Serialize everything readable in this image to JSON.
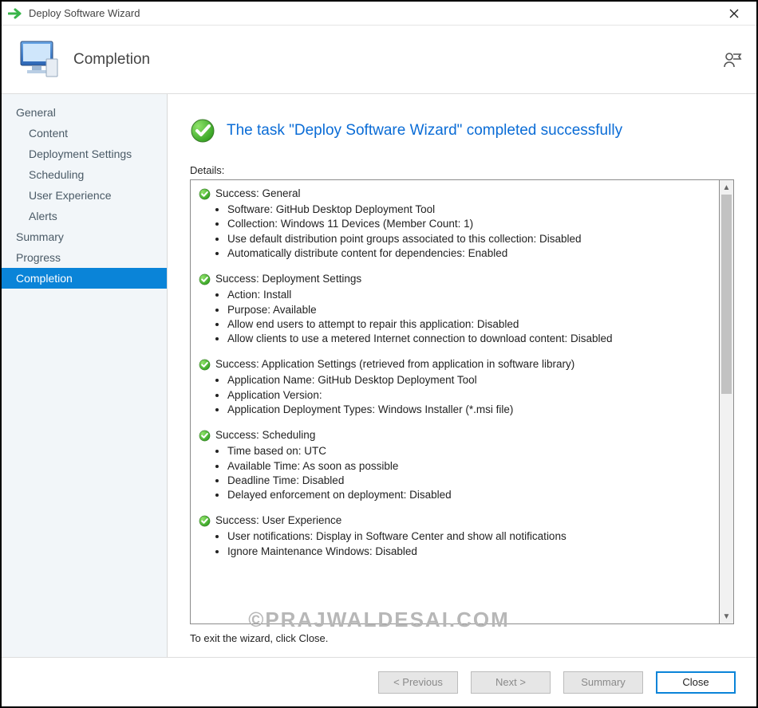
{
  "window": {
    "title": "Deploy Software Wizard"
  },
  "header": {
    "title": "Completion"
  },
  "sidebar": {
    "items": [
      {
        "label": "General",
        "indent": 0,
        "active": false
      },
      {
        "label": "Content",
        "indent": 1,
        "active": false
      },
      {
        "label": "Deployment Settings",
        "indent": 1,
        "active": false
      },
      {
        "label": "Scheduling",
        "indent": 1,
        "active": false
      },
      {
        "label": "User Experience",
        "indent": 1,
        "active": false
      },
      {
        "label": "Alerts",
        "indent": 1,
        "active": false
      },
      {
        "label": "Summary",
        "indent": 0,
        "active": false
      },
      {
        "label": "Progress",
        "indent": 0,
        "active": false
      },
      {
        "label": "Completion",
        "indent": 0,
        "active": true
      }
    ]
  },
  "main": {
    "headline": "The task \"Deploy Software Wizard\" completed successfully",
    "details_label": "Details:",
    "sections": [
      {
        "title": "Success: General",
        "lines": [
          "Software: GitHub Desktop Deployment Tool",
          "Collection: Windows 11 Devices (Member Count: 1)",
          "Use default distribution point groups associated to this collection: Disabled",
          "Automatically distribute content for dependencies: Enabled"
        ]
      },
      {
        "title": "Success: Deployment Settings",
        "lines": [
          "Action: Install",
          "Purpose: Available",
          "Allow end users to attempt to repair this application: Disabled",
          "Allow clients to use a metered Internet connection to download content: Disabled"
        ]
      },
      {
        "title": "Success: Application Settings (retrieved from application in software library)",
        "lines": [
          "Application Name: GitHub Desktop Deployment Tool",
          "Application Version:",
          "Application Deployment Types: Windows Installer (*.msi file)"
        ]
      },
      {
        "title": "Success: Scheduling",
        "lines": [
          "Time based on: UTC",
          "Available Time: As soon as possible",
          "Deadline Time: Disabled",
          "Delayed enforcement on deployment: Disabled"
        ]
      },
      {
        "title": "Success: User Experience",
        "lines": [
          "User notifications: Display in Software Center and show all notifications",
          "Ignore Maintenance Windows: Disabled"
        ]
      }
    ],
    "exit_hint": "To exit the wizard, click Close."
  },
  "footer": {
    "previous": "< Previous",
    "next": "Next >",
    "summary": "Summary",
    "close": "Close"
  },
  "watermark": "©PRAJWALDESAI.COM"
}
